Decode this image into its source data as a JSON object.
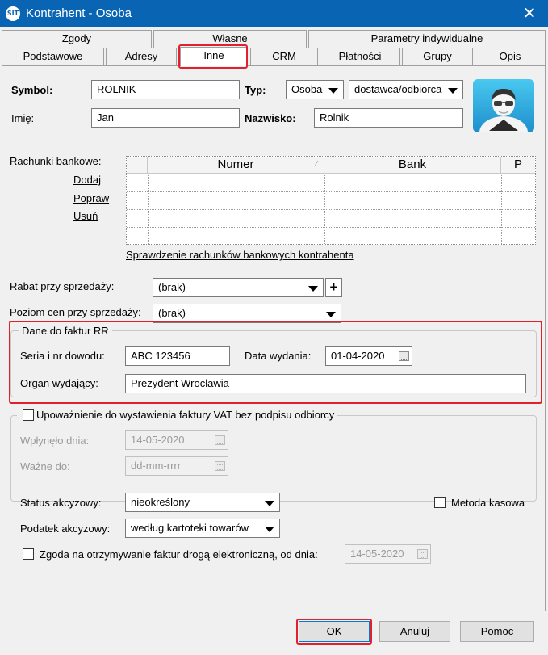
{
  "window": {
    "title": "Kontrahent - Osoba",
    "icon_text": "SIT",
    "close_glyph": "✕"
  },
  "tabs": {
    "row1": [
      "Zgody",
      "Własne",
      "Parametry indywidualne"
    ],
    "row2": [
      "Podstawowe",
      "Adresy",
      "Inne",
      "CRM",
      "Płatności",
      "Grupy",
      "Opis"
    ],
    "active": "Inne"
  },
  "form": {
    "symbol_label": "Symbol:",
    "symbol_value": "ROLNIK",
    "typ_label": "Typ:",
    "typ_value": "Osoba",
    "typ2_value": "dostawca/odbiorca",
    "imie_label": "Imię:",
    "imie_value": "Jan",
    "nazwisko_label": "Nazwisko:",
    "nazwisko_value": "Rolnik"
  },
  "bank": {
    "label": "Rachunki bankowe:",
    "add": "Dodaj",
    "edit": "Popraw",
    "delete": "Usuń",
    "columns": [
      "Numer",
      "Bank",
      "P"
    ],
    "check_link": "Sprawdzenie rachunków bankowych kontrahenta"
  },
  "pricing": {
    "rabat_label": "Rabat przy sprzedaży:",
    "rabat_value": "(brak)",
    "poziom_label": "Poziom cen przy sprzedaży:",
    "poziom_value": "(brak)",
    "plus_glyph": "+"
  },
  "rr": {
    "legend": "Dane do faktur RR",
    "seria_label": "Seria i nr dowodu:",
    "seria_value": "ABC 123456",
    "data_label": "Data wydania:",
    "data_value": "01-04-2020",
    "organ_label": "Organ wydający:",
    "organ_value": "Prezydent Wrocławia"
  },
  "vat": {
    "legend": "Upoważnienie do wystawienia faktury VAT bez podpisu odbiorcy",
    "wplynelo_label": "Wpłynęło dnia:",
    "wplynelo_value": "14-05-2020",
    "wazne_label": "Ważne do:",
    "wazne_value": "dd-mm-rrrr"
  },
  "excise": {
    "status_label": "Status akcyzowy:",
    "status_value": "nieokreślony",
    "metoda_label": "Metoda kasowa",
    "podatek_label": "Podatek akcyzowy:",
    "podatek_value": "według kartoteki towarów",
    "zgoda_label": "Zgoda na otrzymywanie faktur drogą elektroniczną, od dnia:",
    "zgoda_value": "14-05-2020"
  },
  "buttons": {
    "ok": "OK",
    "cancel": "Anuluj",
    "help": "Pomoc"
  },
  "colors": {
    "titlebar": "#0a64b4",
    "highlight": "#e0202a"
  }
}
